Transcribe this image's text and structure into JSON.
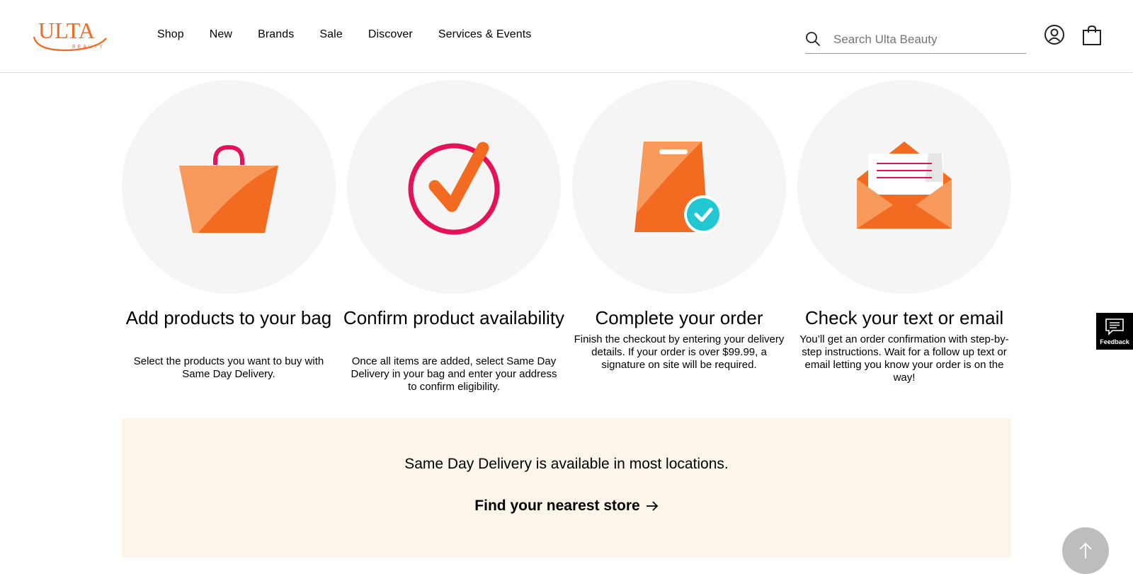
{
  "brand": {
    "logo_text": "ULTA",
    "logo_subtext": "BEAUTY",
    "logo_color": "#f26b21"
  },
  "nav": {
    "items": [
      {
        "label": "Shop"
      },
      {
        "label": "New"
      },
      {
        "label": "Brands"
      },
      {
        "label": "Sale"
      },
      {
        "label": "Discover"
      },
      {
        "label": "Services & Events"
      }
    ]
  },
  "search": {
    "placeholder": "Search Ulta Beauty",
    "value": ""
  },
  "icons": {
    "search": "search-icon",
    "account": "account-icon",
    "bag": "shopping-bag-icon",
    "feedback": "feedback-icon",
    "scroll_top": "arrow-up-icon"
  },
  "steps": [
    {
      "icon": "shopping-bag-icon",
      "title": "Add products to your bag",
      "description": "Select the products you want to buy with Same Day Delivery."
    },
    {
      "icon": "checkmark-circle-icon",
      "title": "Confirm product availability",
      "description": "Once all items are added, select Same Day Delivery in your bag and enter your address to confirm eligibility."
    },
    {
      "icon": "order-bag-check-icon",
      "title": "Complete your order",
      "description": "Finish the checkout by entering your delivery details. If your order is over $99.99, a signature on site will be required."
    },
    {
      "icon": "envelope-letter-icon",
      "title": "Check your text or email",
      "description": "You’ll get an order confirmation with step-by-step instructions. Wait for a follow up text or email letting you know your order is on the way!"
    }
  ],
  "banner": {
    "text": "Same Day Delivery is available in most locations.",
    "link_label": "Find your nearest store"
  },
  "feedback": {
    "label": "Feedback"
  },
  "colors": {
    "orange": "#f26b21",
    "orange_light": "#f89a5b",
    "pink": "#e5125a",
    "teal": "#21c8d3",
    "banner_bg": "#fdf4ea",
    "circle_bg": "#f5f5f5"
  }
}
